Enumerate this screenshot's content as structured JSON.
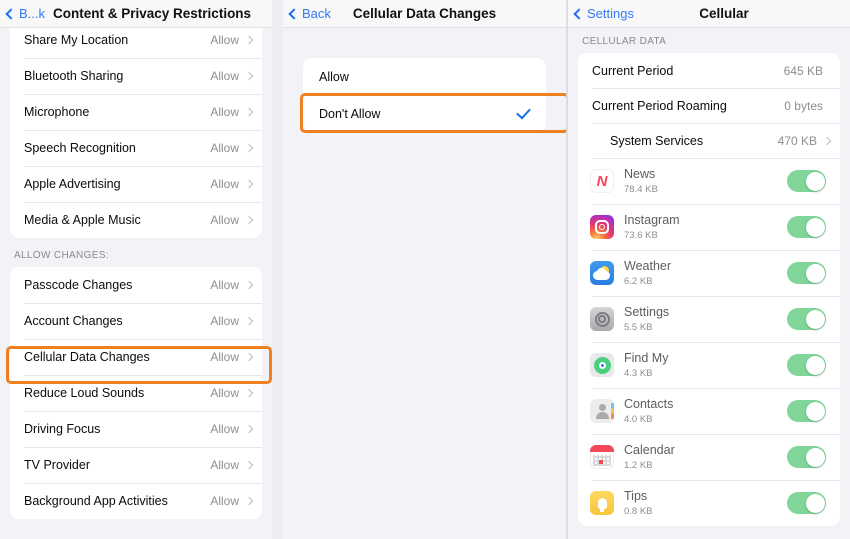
{
  "left_panel": {
    "nav": {
      "back_label": "B...k",
      "title": "Content & Privacy Restrictions"
    },
    "top_rows": [
      {
        "label": "Share My Location",
        "value": "Allow"
      },
      {
        "label": "Bluetooth Sharing",
        "value": "Allow"
      },
      {
        "label": "Microphone",
        "value": "Allow"
      },
      {
        "label": "Speech Recognition",
        "value": "Allow"
      },
      {
        "label": "Apple Advertising",
        "value": "Allow"
      },
      {
        "label": "Media & Apple Music",
        "value": "Allow"
      }
    ],
    "section_header": "ALLOW CHANGES:",
    "changes_rows": [
      {
        "label": "Passcode Changes",
        "value": "Allow"
      },
      {
        "label": "Account Changes",
        "value": "Allow"
      },
      {
        "label": "Cellular Data Changes",
        "value": "Allow"
      },
      {
        "label": "Reduce Loud Sounds",
        "value": "Allow"
      },
      {
        "label": "Driving Focus",
        "value": "Allow"
      },
      {
        "label": "TV Provider",
        "value": "Allow"
      },
      {
        "label": "Background App Activities",
        "value": "Allow"
      }
    ],
    "highlighted_row": "Cellular Data Changes"
  },
  "mid_panel": {
    "nav": {
      "back_label": "Back",
      "title": "Cellular Data Changes"
    },
    "options": [
      {
        "label": "Allow",
        "selected": false
      },
      {
        "label": "Don't Allow",
        "selected": true
      }
    ],
    "highlighted_option": "Don't Allow"
  },
  "right_panel": {
    "nav": {
      "back_label": "Settings",
      "title": "Cellular"
    },
    "section_header": "CELLULAR DATA",
    "usage_rows": [
      {
        "label": "Current Period",
        "value": "645 KB",
        "chevron": false,
        "indent": false
      },
      {
        "label": "Current Period Roaming",
        "value": "0 bytes",
        "chevron": false,
        "indent": false
      },
      {
        "label": "System Services",
        "value": "470 KB",
        "chevron": true,
        "indent": true
      }
    ],
    "apps": [
      {
        "name": "News",
        "size": "78.4 KB",
        "icon": "news-icon",
        "enabled": true
      },
      {
        "name": "Instagram",
        "size": "73.6 KB",
        "icon": "instagram-icon",
        "enabled": true
      },
      {
        "name": "Weather",
        "size": "6.2 KB",
        "icon": "weather-icon",
        "enabled": true
      },
      {
        "name": "Settings",
        "size": "5.5 KB",
        "icon": "settings-icon",
        "enabled": true
      },
      {
        "name": "Find My",
        "size": "4.3 KB",
        "icon": "findmy-icon",
        "enabled": true
      },
      {
        "name": "Contacts",
        "size": "4.0 KB",
        "icon": "contacts-icon",
        "enabled": true
      },
      {
        "name": "Calendar",
        "size": "1.2 KB",
        "icon": "calendar-icon",
        "enabled": true
      },
      {
        "name": "Tips",
        "size": "0.8 KB",
        "icon": "tips-icon",
        "enabled": true
      }
    ]
  },
  "colors": {
    "accent_blue": "#3478f6",
    "highlight_orange": "#ef8022",
    "toggle_green": "#7fd698",
    "panel_bg": "#f2f2f7"
  }
}
